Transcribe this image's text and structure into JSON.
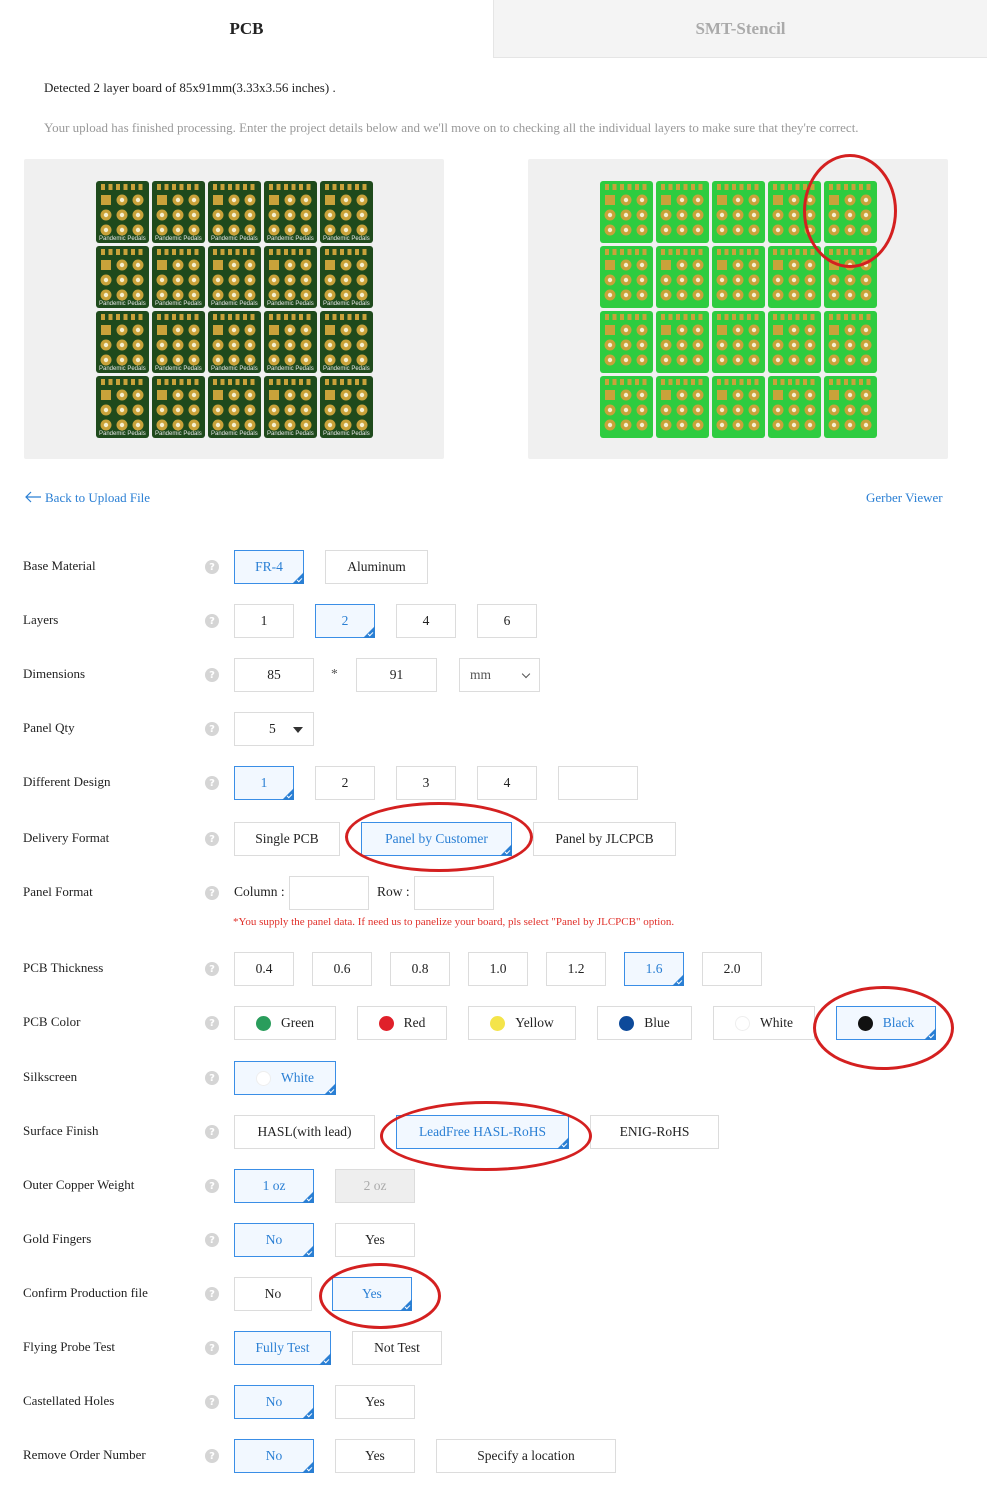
{
  "tabs": {
    "pcb": "PCB",
    "stencil": "SMT-Stencil"
  },
  "info": {
    "detected": "Detected 2 layer board of 85x91mm(3.33x3.56 inches) .",
    "processing": "Your upload has finished processing. Enter the project details below and we'll move on to checking all the individual layers to make sure that they're correct."
  },
  "preview": {
    "board_text": "Pandemic Pedals",
    "colors": {
      "dark_board": "#1f4a1c",
      "bright_board": "#2ecc40",
      "pad": "#c9a23a"
    }
  },
  "links": {
    "back": "Back to Upload File",
    "gerber": "Gerber Viewer"
  },
  "form": {
    "base_material": {
      "label": "Base Material",
      "options": [
        "FR-4",
        "Aluminum"
      ]
    },
    "layers": {
      "label": "Layers",
      "options": [
        "1",
        "2",
        "4",
        "6"
      ]
    },
    "dimensions": {
      "label": "Dimensions",
      "width": "85",
      "times": "*",
      "height": "91",
      "unit": "mm"
    },
    "panel_qty": {
      "label": "Panel Qty",
      "value": "5"
    },
    "different_design": {
      "label": "Different Design",
      "options": [
        "1",
        "2",
        "3",
        "4"
      ],
      "custom": ""
    },
    "delivery_format": {
      "label": "Delivery Format",
      "options": [
        "Single PCB",
        "Panel by Customer",
        "Panel by JLCPCB"
      ]
    },
    "panel_format": {
      "label": "Panel Format",
      "column_label": "Column :",
      "column_value": "",
      "row_label": "Row :",
      "row_value": "",
      "note": "*You supply the panel data. If need us to panelize your board, pls select \"Panel by JLCPCB\" option."
    },
    "pcb_thickness": {
      "label": "PCB Thickness",
      "options": [
        "0.4",
        "0.6",
        "0.8",
        "1.0",
        "1.2",
        "1.6",
        "2.0"
      ]
    },
    "pcb_color": {
      "label": "PCB Color",
      "options": [
        "Green",
        "Red",
        "Yellow",
        "Blue",
        "White",
        "Black"
      ],
      "colors": [
        "#2a9d5c",
        "#e0202a",
        "#f4e44a",
        "#0d4a9a",
        "#ffffff",
        "#111111"
      ]
    },
    "silkscreen": {
      "label": "Silkscreen",
      "options": [
        "White"
      ]
    },
    "surface_finish": {
      "label": "Surface Finish",
      "options": [
        "HASL(with lead)",
        "LeadFree HASL-RoHS",
        "ENIG-RoHS"
      ]
    },
    "outer_copper": {
      "label": "Outer Copper Weight",
      "options": [
        "1 oz",
        "2 oz"
      ]
    },
    "gold_fingers": {
      "label": "Gold Fingers",
      "options": [
        "No",
        "Yes"
      ]
    },
    "confirm_production": {
      "label": "Confirm Production file",
      "options": [
        "No",
        "Yes"
      ]
    },
    "flying_probe": {
      "label": "Flying Probe Test",
      "options": [
        "Fully Test",
        "Not Test"
      ]
    },
    "castellated": {
      "label": "Castellated Holes",
      "options": [
        "No",
        "Yes"
      ]
    },
    "remove_order_number": {
      "label": "Remove Order Number",
      "options": [
        "No",
        "Yes",
        "Specify a location"
      ]
    }
  },
  "help_glyph": "?",
  "accent_color": "#2a7fd4",
  "annotation_color": "#d42020"
}
